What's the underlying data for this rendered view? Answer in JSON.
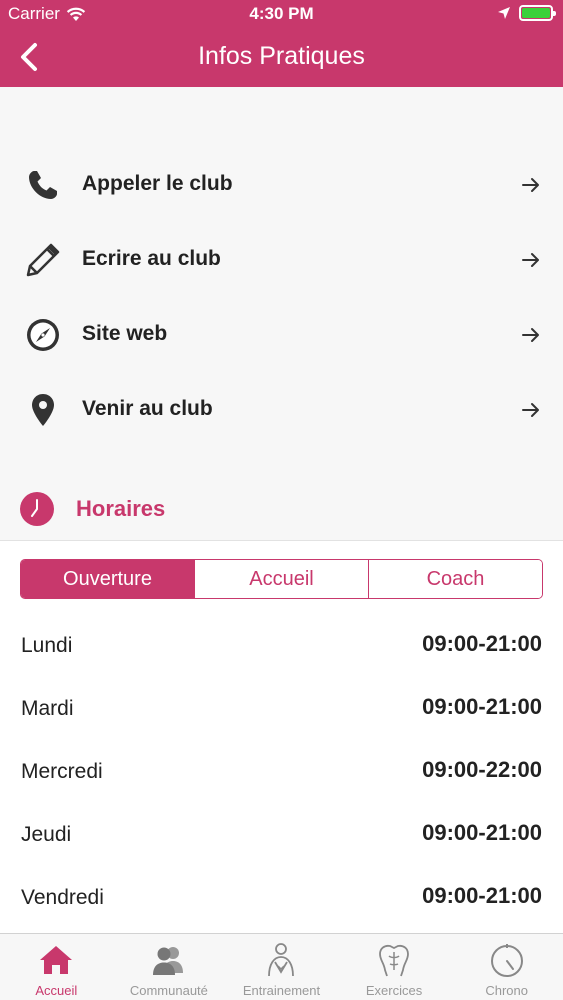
{
  "status_bar": {
    "carrier": "Carrier",
    "time": "4:30 PM"
  },
  "nav": {
    "title": "Infos Pratiques"
  },
  "contact_items": [
    {
      "label": "Appeler le club",
      "icon": "phone-icon"
    },
    {
      "label": "Ecrire au club",
      "icon": "pencil-icon"
    },
    {
      "label": "Site web",
      "icon": "compass-icon"
    },
    {
      "label": "Venir au club",
      "icon": "map-pin-icon"
    }
  ],
  "horaires": {
    "title": "Horaires"
  },
  "segments": [
    {
      "label": "Ouverture",
      "active": true
    },
    {
      "label": "Accueil",
      "active": false
    },
    {
      "label": "Coach",
      "active": false
    }
  ],
  "hours": [
    {
      "day": "Lundi",
      "time": "09:00-21:00"
    },
    {
      "day": "Mardi",
      "time": "09:00-21:00"
    },
    {
      "day": "Mercredi",
      "time": "09:00-22:00"
    },
    {
      "day": "Jeudi",
      "time": "09:00-21:00"
    },
    {
      "day": "Vendredi",
      "time": "09:00-21:00"
    }
  ],
  "tabs": [
    {
      "label": "Accueil",
      "icon": "home-icon",
      "active": true
    },
    {
      "label": "Communauté",
      "icon": "community-icon",
      "active": false
    },
    {
      "label": "Entrainement",
      "icon": "training-icon",
      "active": false
    },
    {
      "label": "Exercices",
      "icon": "exercises-icon",
      "active": false
    },
    {
      "label": "Chrono",
      "icon": "chrono-icon",
      "active": false
    }
  ],
  "colors": {
    "accent": "#c8386c",
    "inactive": "#999999",
    "battery": "#3ad13a"
  }
}
